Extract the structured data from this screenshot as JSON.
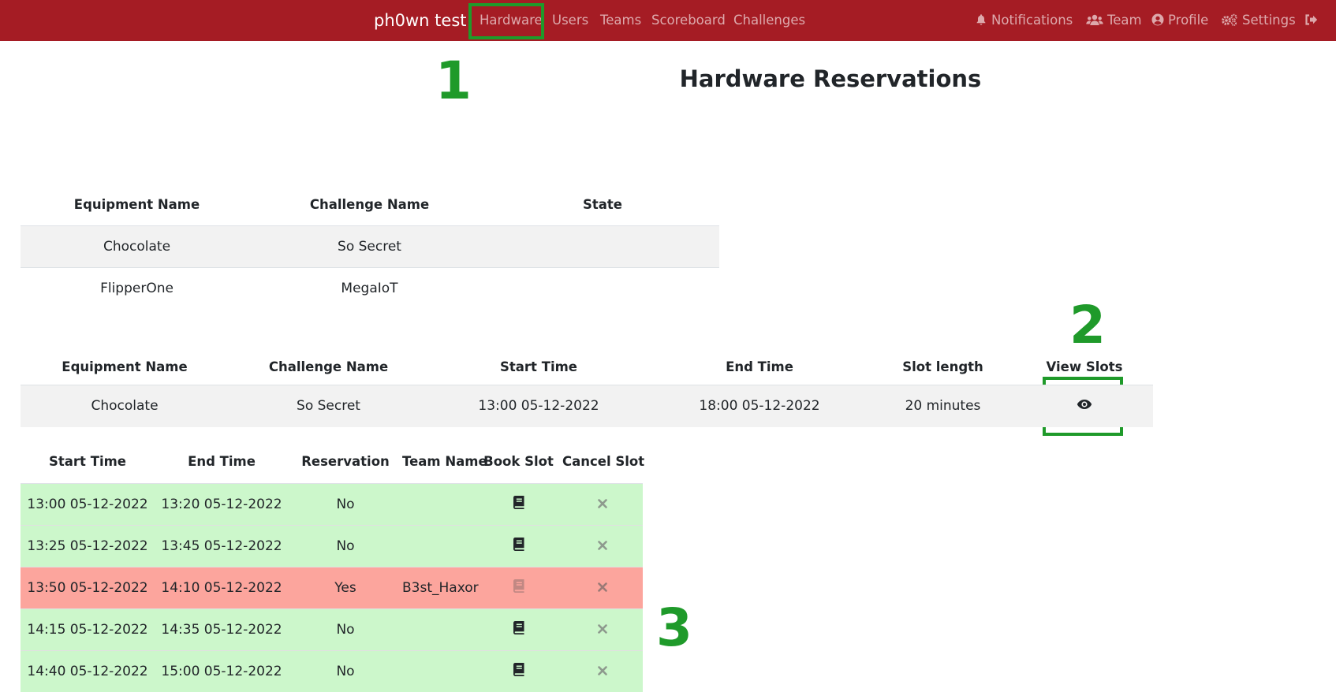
{
  "navbar": {
    "brand": "ph0wn test",
    "links": [
      "Hardware",
      "Users",
      "Teams",
      "Scoreboard",
      "Challenges"
    ],
    "right": {
      "notifications": "Notifications",
      "team": "Team",
      "profile": "Profile",
      "settings": "Settings"
    },
    "icons": {
      "notifications": "bell-icon",
      "team": "users-icon",
      "profile": "user-circle-icon",
      "settings": "cogs-icon",
      "logout": "logout-icon"
    },
    "bg_color": "#a51c24"
  },
  "annotations": {
    "n1": "1",
    "n2": "2",
    "n3": "3",
    "color": "#1f9a2a"
  },
  "page_title": "Hardware Reservations",
  "equipment_table": {
    "headers": [
      "Equipment Name",
      "Challenge Name",
      "State"
    ],
    "rows": [
      {
        "equipment": "Chocolate",
        "challenge": "So Secret",
        "state": ""
      },
      {
        "equipment": "FlipperOne",
        "challenge": "MegaIoT",
        "state": ""
      }
    ]
  },
  "schedule_table": {
    "headers": [
      "Equipment Name",
      "Challenge Name",
      "Start Time",
      "End Time",
      "Slot length",
      "View Slots"
    ],
    "row": {
      "equipment": "Chocolate",
      "challenge": "So Secret",
      "start": "13:00 05-12-2022",
      "end": "18:00 05-12-2022",
      "slot_length": "20 minutes",
      "view_icon": "eye-icon"
    }
  },
  "slots_table": {
    "headers": [
      "Start Time",
      "End Time",
      "Reservation",
      "Team Name",
      "Book Slot",
      "Cancel Slot"
    ],
    "rows": [
      {
        "start": "13:00 05-12-2022",
        "end": "13:20 05-12-2022",
        "reservation": "No",
        "team": "",
        "status": "free"
      },
      {
        "start": "13:25 05-12-2022",
        "end": "13:45 05-12-2022",
        "reservation": "No",
        "team": "",
        "status": "free"
      },
      {
        "start": "13:50 05-12-2022",
        "end": "14:10 05-12-2022",
        "reservation": "Yes",
        "team": "B3st_Haxor",
        "status": "reserved"
      },
      {
        "start": "14:15 05-12-2022",
        "end": "14:35 05-12-2022",
        "reservation": "No",
        "team": "",
        "status": "free"
      },
      {
        "start": "14:40 05-12-2022",
        "end": "15:00 05-12-2022",
        "reservation": "No",
        "team": "",
        "status": "free"
      }
    ],
    "colors": {
      "free": "#ccf7cb",
      "reserved": "#fca59d"
    },
    "book_icon": "book-icon",
    "cancel_icon": "times-icon"
  }
}
